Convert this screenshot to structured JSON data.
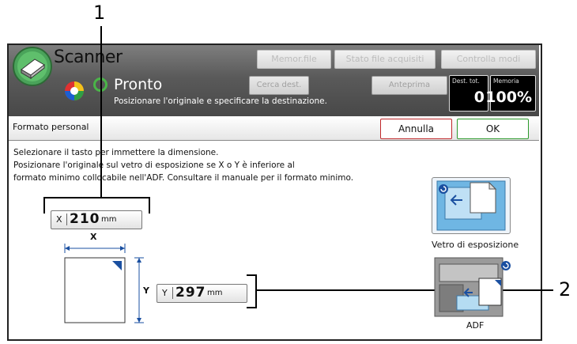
{
  "callouts": {
    "one": "1",
    "two": "2"
  },
  "header": {
    "app_title": "Scanner",
    "buttons": {
      "stored_file": "Memor.file",
      "scanned_file_status": "Stato file acquisiti",
      "check_modes": "Controlla modi"
    },
    "status": "Pronto",
    "status_sub": "Posizionare l'originale e specificare la destinazione.",
    "search_dest": "Cerca dest.",
    "preview": "Anteprima",
    "dest_total": {
      "label": "Dest. tot.",
      "value": "0"
    },
    "memory": {
      "label": "Memoria",
      "value": "100%"
    }
  },
  "bar": {
    "title": "Formato personal",
    "cancel": "Annulla",
    "ok": "OK"
  },
  "instructions": [
    "Selezionare il tasto per immettere la dimensione.",
    "Posizionare l'originale sul vetro di esposizione se X o Y è inferiore al",
    "formato minimo collocabile nell'ADF. Consultare il manuale per il formato minimo."
  ],
  "x_field": {
    "axis": "X",
    "value": "210",
    "unit": "mm"
  },
  "y_field": {
    "axis": "Y",
    "value": "297",
    "unit": "mm"
  },
  "diagram": {
    "x_label": "X",
    "y_label": "Y"
  },
  "sources": {
    "glass": "Vetro di esposizione",
    "adf": "ADF"
  },
  "colors": {
    "accent_red": "#c0282b",
    "accent_green": "#2c9a2c",
    "diagram_blue": "#1a4fa0"
  }
}
